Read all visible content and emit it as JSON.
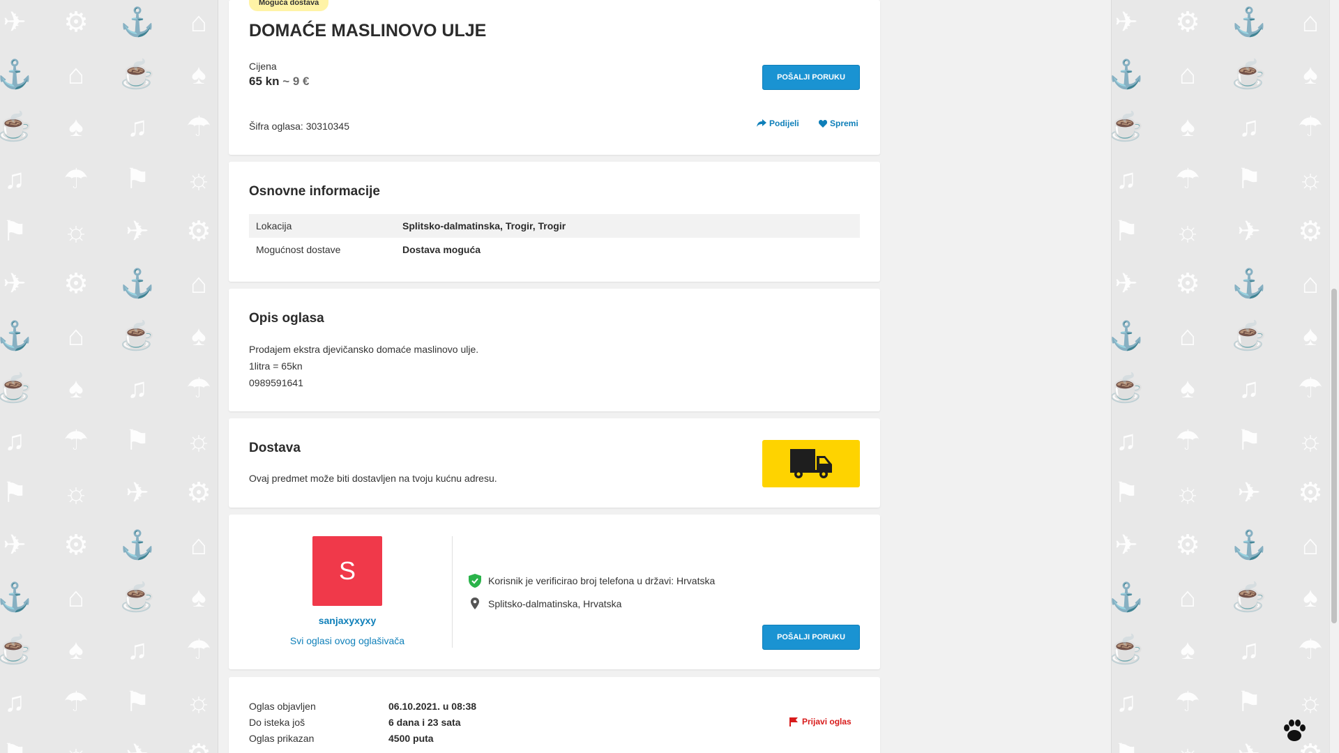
{
  "ad": {
    "badge": "Moguća dostava",
    "title": "DOMAĆE MASLINOVO ULJE",
    "price_label": "Cijena",
    "price_kn": "65 kn",
    "price_eur": "~ 9 €",
    "ad_id": "Šifra oglasa: 30310345",
    "share": "Podijeli",
    "save": "Spremi",
    "send_message": "POŠALJI PORUKU"
  },
  "basic_info": {
    "title": "Osnovne informacije",
    "rows": [
      {
        "key": "Lokacija",
        "value": "Splitsko-dalmatinska, Trogir, Trogir"
      },
      {
        "key": "Mogućnost dostave",
        "value": "Dostava moguća"
      }
    ]
  },
  "description": {
    "title": "Opis oglasa",
    "lines": [
      "Prodajem ekstra djevičansko domaće maslinovo ulje.",
      "1litra = 65kn",
      "0989591641"
    ]
  },
  "delivery": {
    "title": "Dostava",
    "text": "Ovaj predmet može biti dostavljen na tvoju kućnu adresu.",
    "icon": "truck-icon"
  },
  "seller": {
    "avatar_letter": "S",
    "username": "sanjaxyxyxy",
    "all_ads": "Svi oglasi ovog oglašivača",
    "verified": "Korisnik je verificirao broj telefona u državi: Hrvatska",
    "location": "Splitsko-dalmatinska, Hrvatska",
    "send_message": "POŠALJI PORUKU"
  },
  "meta": {
    "rows": [
      {
        "key": "Oglas objavljen",
        "value": "06.10.2021. u 08:38"
      },
      {
        "key": "Do isteka još",
        "value": "6 dana i 23 sata"
      },
      {
        "key": "Oglas prikazan",
        "value": "4500 puta"
      }
    ],
    "report": "Prijavi oglas"
  },
  "colors": {
    "accent": "#1a93d2",
    "link": "#0e7fb9",
    "avatar": "#f0394a",
    "delivery": "#fed300",
    "report": "#d81b1b",
    "verified": "#2ab34a"
  }
}
